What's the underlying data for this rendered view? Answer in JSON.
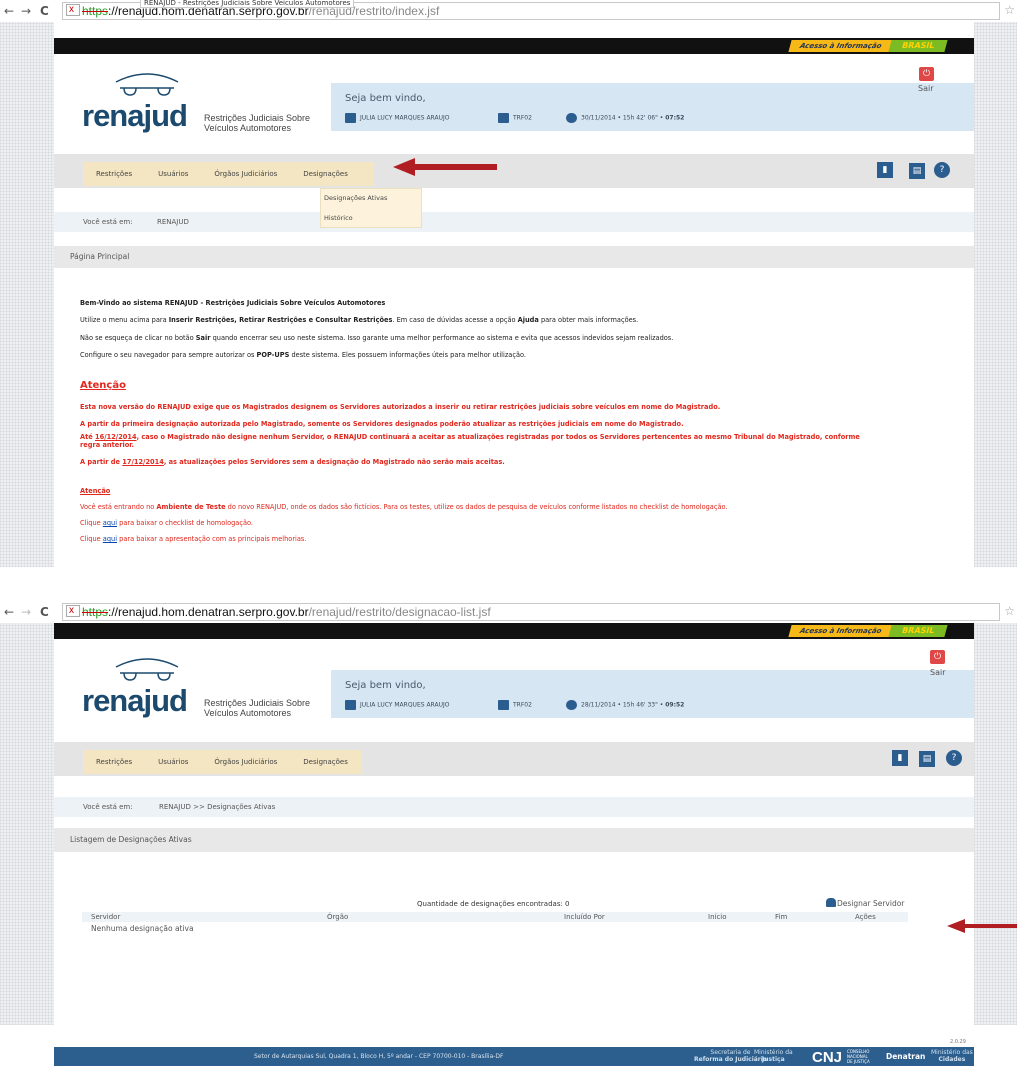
{
  "screen1": {
    "browser": {
      "back": "←",
      "forward": "→",
      "reload": "C",
      "url_scheme": "https",
      "url_host": "://renajud.hom.denatran.serpro.gov.br",
      "url_path": "/renajud/restrito/index.jsf",
      "tab_title": "RENAJUD - Restrições Judiciais Sobre Veículos Automotores",
      "star": "☆"
    },
    "gov": {
      "acesso": "Acesso à Informação",
      "brasil": "BRASIL"
    },
    "logo": {
      "name": "renajud",
      "sub1": "Restrições Judiciais Sobre",
      "sub2": "Veículos Automotores"
    },
    "info": {
      "welcome": "Seja bem vindo,",
      "user": "JULIA LUCY MARQUES ARAUJO",
      "org": "TRF02",
      "datetime": "30/11/2014 • 15h 42' 06\" • ",
      "timer": "07:52",
      "sair": "Sair"
    },
    "menu": [
      "Restrições",
      "Usuários",
      "Órgãos Judiciários",
      "Designações"
    ],
    "dropdown": [
      "Designações Ativas",
      "Histórico"
    ],
    "breadcrumb": {
      "label": "Você está em:",
      "path": "RENAJUD"
    },
    "page_title": "Página Principal",
    "welcome_title": "Bem-Vindo ao sistema RENAJUD - Restrições Judiciais Sobre Veículos Automotores",
    "p1_a": "Utilize o menu acima para ",
    "p1_b": "Inserir Restrições, Retirar Restrições e Consultar Restrições",
    "p1_c": ". Em caso de dúvidas acesse a opção ",
    "p1_d": "Ajuda",
    "p1_e": " para obter mais informações.",
    "p2_a": "Não se esqueça de clicar no botão ",
    "p2_b": "Sair",
    "p2_c": " quando encerrar seu uso neste sistema. Isso garante uma melhor performance ao sistema e evita que acessos indevidos sejam realizados.",
    "p3_a": "Configure o seu navegador para sempre autorizar os ",
    "p3_b": "POP-UPS",
    "p3_c": " deste sistema. Eles possuem informações úteis para melhor utilização.",
    "atencao": "Atenção",
    "a1": "Esta nova versão do RENAJUD exige que os Magistrados designem os Servidores autorizados a inserir ou retirar restrições judiciais sobre veículos em nome do Magistrado.",
    "a2": "A partir da primeira designação autorizada pelo Magistrado, somente os Servidores designados poderão atualizar as restrições judiciais em nome do Magistrado.",
    "a3_pre": "Até ",
    "a3_date": "16/12/2014",
    "a3_post": ", caso o Magistrado não designe nenhum Servidor, o RENAJUD continuará a aceitar as atualizações registradas por todos os Servidores pertencentes ao mesmo Tribunal do Magistrado, conforme",
    "a3_line2": "regra anterior.",
    "a4_pre": "A partir de ",
    "a4_date": "17/12/2014",
    "a4_post": ", as atualizações pelos Servidores sem a designação do Magistrado não serão mais aceitas.",
    "atencao2": "Atenção",
    "b1_a": "Você está entrando no ",
    "b1_b": "Ambiente de Teste",
    "b1_c": " do novo RENAJUD, onde os dados são fictícios. Para os testes, utilize os dados de pesquisa de veículos conforme listados no checklist de homologação.",
    "b2_a": "Clique ",
    "b2_link": "aqui",
    "b2_b": " para baixar o checklist de homologação.",
    "b3_a": "Clique ",
    "b3_link": "aqui",
    "b3_b": " para baixar a apresentação com as principais melhorias."
  },
  "screen2": {
    "browser": {
      "url_scheme": "https",
      "url_host": "://renajud.hom.denatran.serpro.gov.br",
      "url_path": "/renajud/restrito/designacao-list.jsf"
    },
    "info": {
      "welcome": "Seja bem vindo,",
      "user": "JULIA LUCY MARQUES ARAUJO",
      "org": "TRF02",
      "datetime": "28/11/2014 • 15h 46' 33\" • ",
      "timer": "09:52",
      "sair": "Sair"
    },
    "breadcrumb": {
      "label": "Você está em:",
      "path": "RENAJUD  >>  Designações Ativas"
    },
    "page_title": "Listagem de Designações Ativas",
    "count_text": "Quantidade de designações encontradas: 0",
    "designar": "Designar Servidor",
    "columns": [
      "Servidor",
      "Órgão",
      "Incluído Por",
      "Início",
      "Fim",
      "Ações"
    ],
    "empty": "Nenhuma designação ativa"
  },
  "footer": {
    "address": "Setor de Autarquias Sul, Quadra 1, Bloco H, 5º andar - CEP 70700-010 - Brasília-DF",
    "org1_l1": "Secretaria de",
    "org1_l2": "Reforma do Judiciário",
    "org2_l1": "Ministério da",
    "org2_l2": "Justiça",
    "cnj": "CNJ",
    "cnj_sub1": "CONSELHO",
    "cnj_sub2": "NACIONAL",
    "cnj_sub3": "DE JUSTIÇA",
    "denatran": "Denatran",
    "org3_l1": "Ministério das",
    "org3_l2": "Cidades",
    "version": "2.0.29"
  },
  "colors": {
    "accent_blue": "#2c5d8f",
    "menu_bg": "#f4e6c2",
    "alert_red": "#e0281e",
    "arrow_red": "#b01e24"
  }
}
